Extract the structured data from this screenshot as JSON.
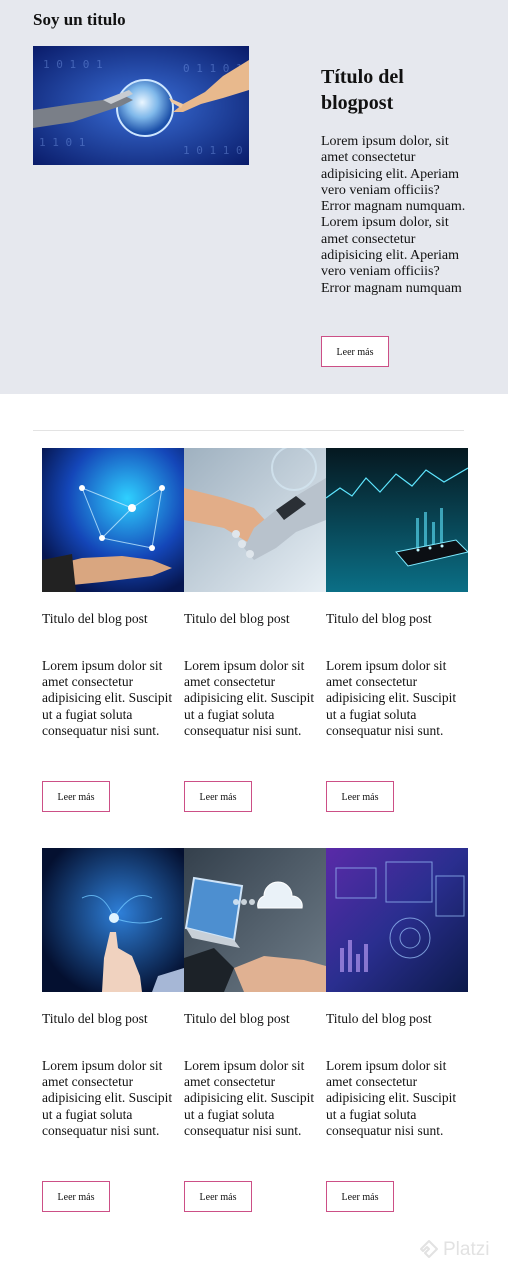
{
  "header": {
    "site_title": "Soy un titulo"
  },
  "featured": {
    "title": "Título del blogpost",
    "text": "Lorem ipsum dolor, sit amet consectetur adipisicing elit. Aperiam vero veniam officiis? Error magnam numquam. Lorem ipsum dolor, sit amet consectetur adipisicing elit. Aperiam vero veniam officiis? Error magnam numquam",
    "button_label": "Leer más"
  },
  "posts": [
    {
      "title": "Titulo del blog post",
      "text": "Lorem ipsum dolor sit amet consectetur adipisicing elit. Suscipit ut a fugiat soluta consequatur nisi sunt.",
      "button_label": "Leer más"
    },
    {
      "title": "Titulo del blog post",
      "text": "Lorem ipsum dolor sit amet consectetur adipisicing elit. Suscipit ut a fugiat soluta consequatur nisi sunt.",
      "button_label": "Leer más"
    },
    {
      "title": "Titulo del blog post",
      "text": "Lorem ipsum dolor sit amet consectetur adipisicing elit. Suscipit ut a fugiat soluta consequatur nisi sunt.",
      "button_label": "Leer más"
    },
    {
      "title": "Titulo del blog post",
      "text": "Lorem ipsum dolor sit amet consectetur adipisicing elit. Suscipit ut a fugiat soluta consequatur nisi sunt.",
      "button_label": "Leer más"
    },
    {
      "title": "Titulo del blog post",
      "text": "Lorem ipsum dolor sit amet consectetur adipisicing elit. Suscipit ut a fugiat soluta consequatur nisi sunt.",
      "button_label": "Leer más"
    },
    {
      "title": "Titulo del blog post",
      "text": "Lorem ipsum dolor sit amet consectetur adipisicing elit. Suscipit ut a fugiat soluta consequatur nisi sunt.",
      "button_label": "Leer más"
    }
  ],
  "watermark": {
    "label": "Platzi"
  },
  "colors": {
    "hero_background": "#e6e8ee",
    "button_border": "#cc4f86",
    "watermark": "#e2e2e2"
  }
}
